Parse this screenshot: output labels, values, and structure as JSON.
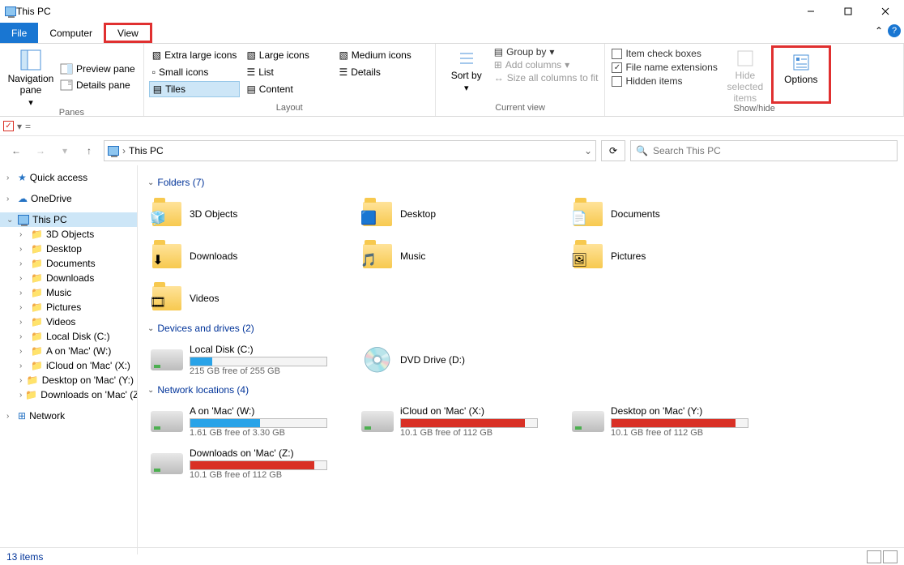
{
  "window": {
    "title": "This PC"
  },
  "tabs": {
    "file": "File",
    "computer": "Computer",
    "view": "View"
  },
  "ribbon": {
    "panes": {
      "nav": "Navigation pane",
      "preview": "Preview pane",
      "details": "Details pane",
      "group": "Panes"
    },
    "layout": {
      "xl": "Extra large icons",
      "lg": "Large icons",
      "md": "Medium icons",
      "sm": "Small icons",
      "list": "List",
      "details": "Details",
      "tiles": "Tiles",
      "content": "Content",
      "group": "Layout"
    },
    "current": {
      "sort": "Sort by",
      "groupby": "Group by",
      "addcols": "Add columns",
      "sizeall": "Size all columns to fit",
      "group": "Current view"
    },
    "show": {
      "item_cb": "Item check boxes",
      "ext": "File name extensions",
      "hidden": "Hidden items",
      "hide_sel": "Hide selected items",
      "options": "Options",
      "group": "Show/hide"
    }
  },
  "address": {
    "location": "This PC"
  },
  "search": {
    "placeholder": "Search This PC"
  },
  "tree": {
    "quick": "Quick access",
    "onedrive": "OneDrive",
    "thispc": "This PC",
    "children": [
      "3D Objects",
      "Desktop",
      "Documents",
      "Downloads",
      "Music",
      "Pictures",
      "Videos",
      "Local Disk (C:)",
      "A on 'Mac' (W:)",
      "iCloud on 'Mac' (X:)",
      "Desktop on 'Mac' (Y:)",
      "Downloads on 'Mac' (Z:)"
    ],
    "network": "Network"
  },
  "sections": {
    "folders": "Folders (7)",
    "drives": "Devices and drives (2)",
    "netloc": "Network locations (4)"
  },
  "folders": [
    "3D Objects",
    "Desktop",
    "Documents",
    "Downloads",
    "Music",
    "Pictures",
    "Videos"
  ],
  "drives": [
    {
      "name": "Local Disk (C:)",
      "sub": "215 GB free of 255 GB",
      "fill": 16,
      "color": "blue"
    },
    {
      "name": "DVD Drive (D:)",
      "sub": "",
      "fill": 0,
      "color": ""
    }
  ],
  "netloc": [
    {
      "name": "A on 'Mac' (W:)",
      "sub": "1.61 GB free of 3.30 GB",
      "fill": 51,
      "color": "blue"
    },
    {
      "name": "iCloud on 'Mac' (X:)",
      "sub": "10.1 GB free of 112 GB",
      "fill": 91,
      "color": "red"
    },
    {
      "name": "Desktop on 'Mac' (Y:)",
      "sub": "10.1 GB free of 112 GB",
      "fill": 91,
      "color": "red"
    },
    {
      "name": "Downloads on 'Mac' (Z:)",
      "sub": "10.1 GB free of 112 GB",
      "fill": 91,
      "color": "red"
    }
  ],
  "status": {
    "count": "13 items"
  }
}
